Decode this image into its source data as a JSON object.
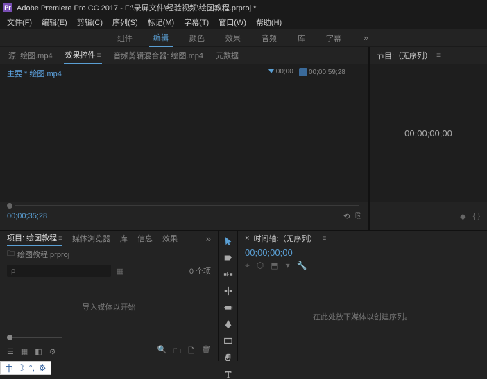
{
  "titlebar": {
    "app_icon_text": "Pr",
    "title": "Adobe Premiere Pro CC 2017 - F:\\录屏文件\\经验视频\\绘图教程.prproj *"
  },
  "menubar": {
    "items": [
      "文件(F)",
      "编辑(E)",
      "剪辑(C)",
      "序列(S)",
      "标记(M)",
      "字幕(T)",
      "窗口(W)",
      "帮助(H)"
    ]
  },
  "workspace": {
    "tabs": [
      "组件",
      "编辑",
      "颜色",
      "效果",
      "音频",
      "库",
      "字幕"
    ],
    "active_index": 1,
    "more": "»"
  },
  "source_panel": {
    "tabs": [
      "源: 绘图.mp4",
      "效果控件",
      "音频剪辑混合器: 绘图.mp4",
      "元数据"
    ],
    "active_index": 1,
    "clip_label": "主要 * 绘图.mp4",
    "ruler_start": ":00;00",
    "ruler_marker": "00;00;59;28",
    "timecode": "00;00;35;28"
  },
  "program_panel": {
    "header": "节目:（无序列）",
    "timecode": "00;00;00;00"
  },
  "project_panel": {
    "tabs": [
      "项目: 绘图教程",
      "媒体浏览器",
      "库",
      "信息",
      "效果"
    ],
    "active_index": 0,
    "path": "绘图教程.prproj",
    "search_placeholder": "ρ",
    "item_count": "0 个项",
    "empty_text": "导入媒体以开始"
  },
  "timeline_panel": {
    "header": "时间轴:（无序列）",
    "timecode": "00;00;00;00",
    "empty_text": "在此处放下媒体以创建序列。"
  },
  "ime": {
    "label": "中"
  }
}
